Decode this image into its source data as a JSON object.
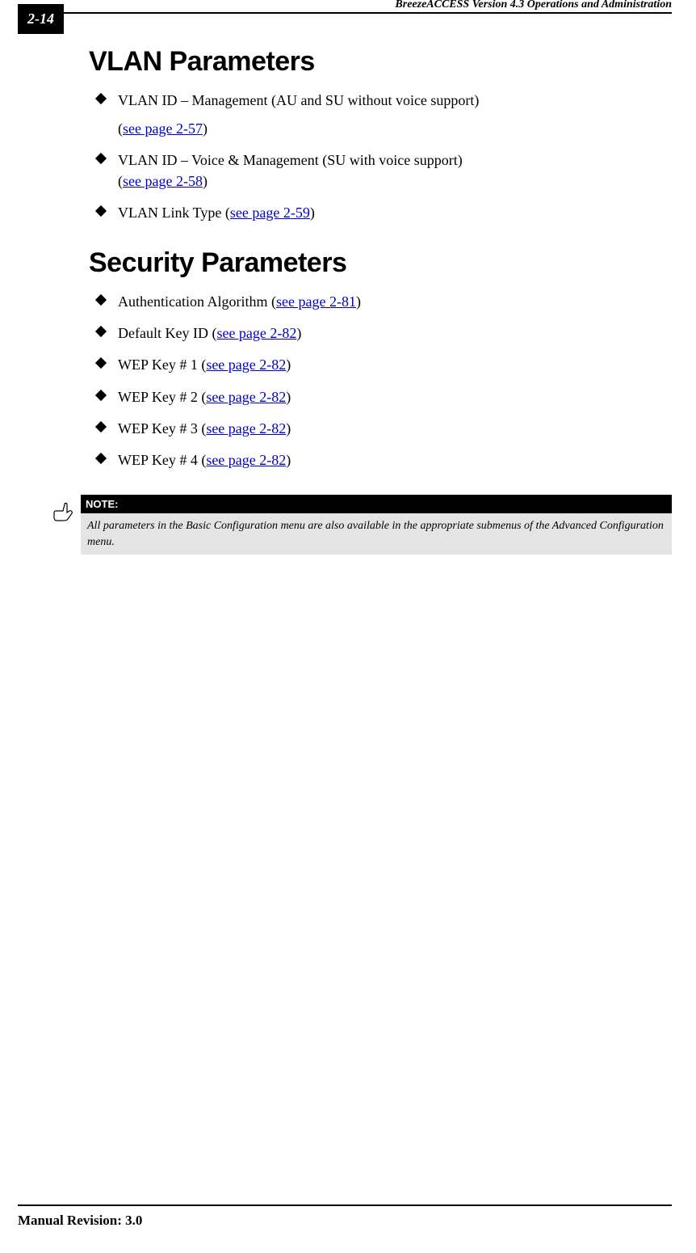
{
  "page_number": "2-14",
  "header_title": "BreezeACCESS Version 4.3 Operations and Administration",
  "headings": {
    "vlan": "VLAN Parameters",
    "security": "Security Parameters"
  },
  "vlan_items": [
    {
      "text": "VLAN ID – Management (AU and SU without voice support)",
      "pre": "(",
      "link": "see page 2-57",
      "post": ")",
      "wrap": true
    },
    {
      "text": "VLAN ID – Voice & Management (SU with voice support)\n(",
      "link": "see page 2-58",
      "post": ")"
    },
    {
      "text": "VLAN Link Type (",
      "link": "see page 2-59",
      "post": ")"
    }
  ],
  "security_items": [
    {
      "text": "Authentication Algorithm (",
      "link": "see page 2-81",
      "post": ")"
    },
    {
      "text": "Default Key ID (",
      "link": "see page 2-82",
      "post": ")"
    },
    {
      "text": "WEP Key # 1 (",
      "link": "see page 2-82",
      "post": ")"
    },
    {
      "text": "WEP Key # 2 (",
      "link": "see page 2-82",
      "post": ")"
    },
    {
      "text": "WEP Key # 3 (",
      "link": "see page 2-82",
      "post": ")"
    },
    {
      "text": "WEP Key # 4 (",
      "link": "see page 2-82",
      "post": ")"
    }
  ],
  "note": {
    "label": "NOTE:",
    "body_plain": "All parameters in the Basic Configuration menu are also available in the appropriate submenus of the Advanced Configuration menu."
  },
  "footer": "Manual Revision: 3.0"
}
